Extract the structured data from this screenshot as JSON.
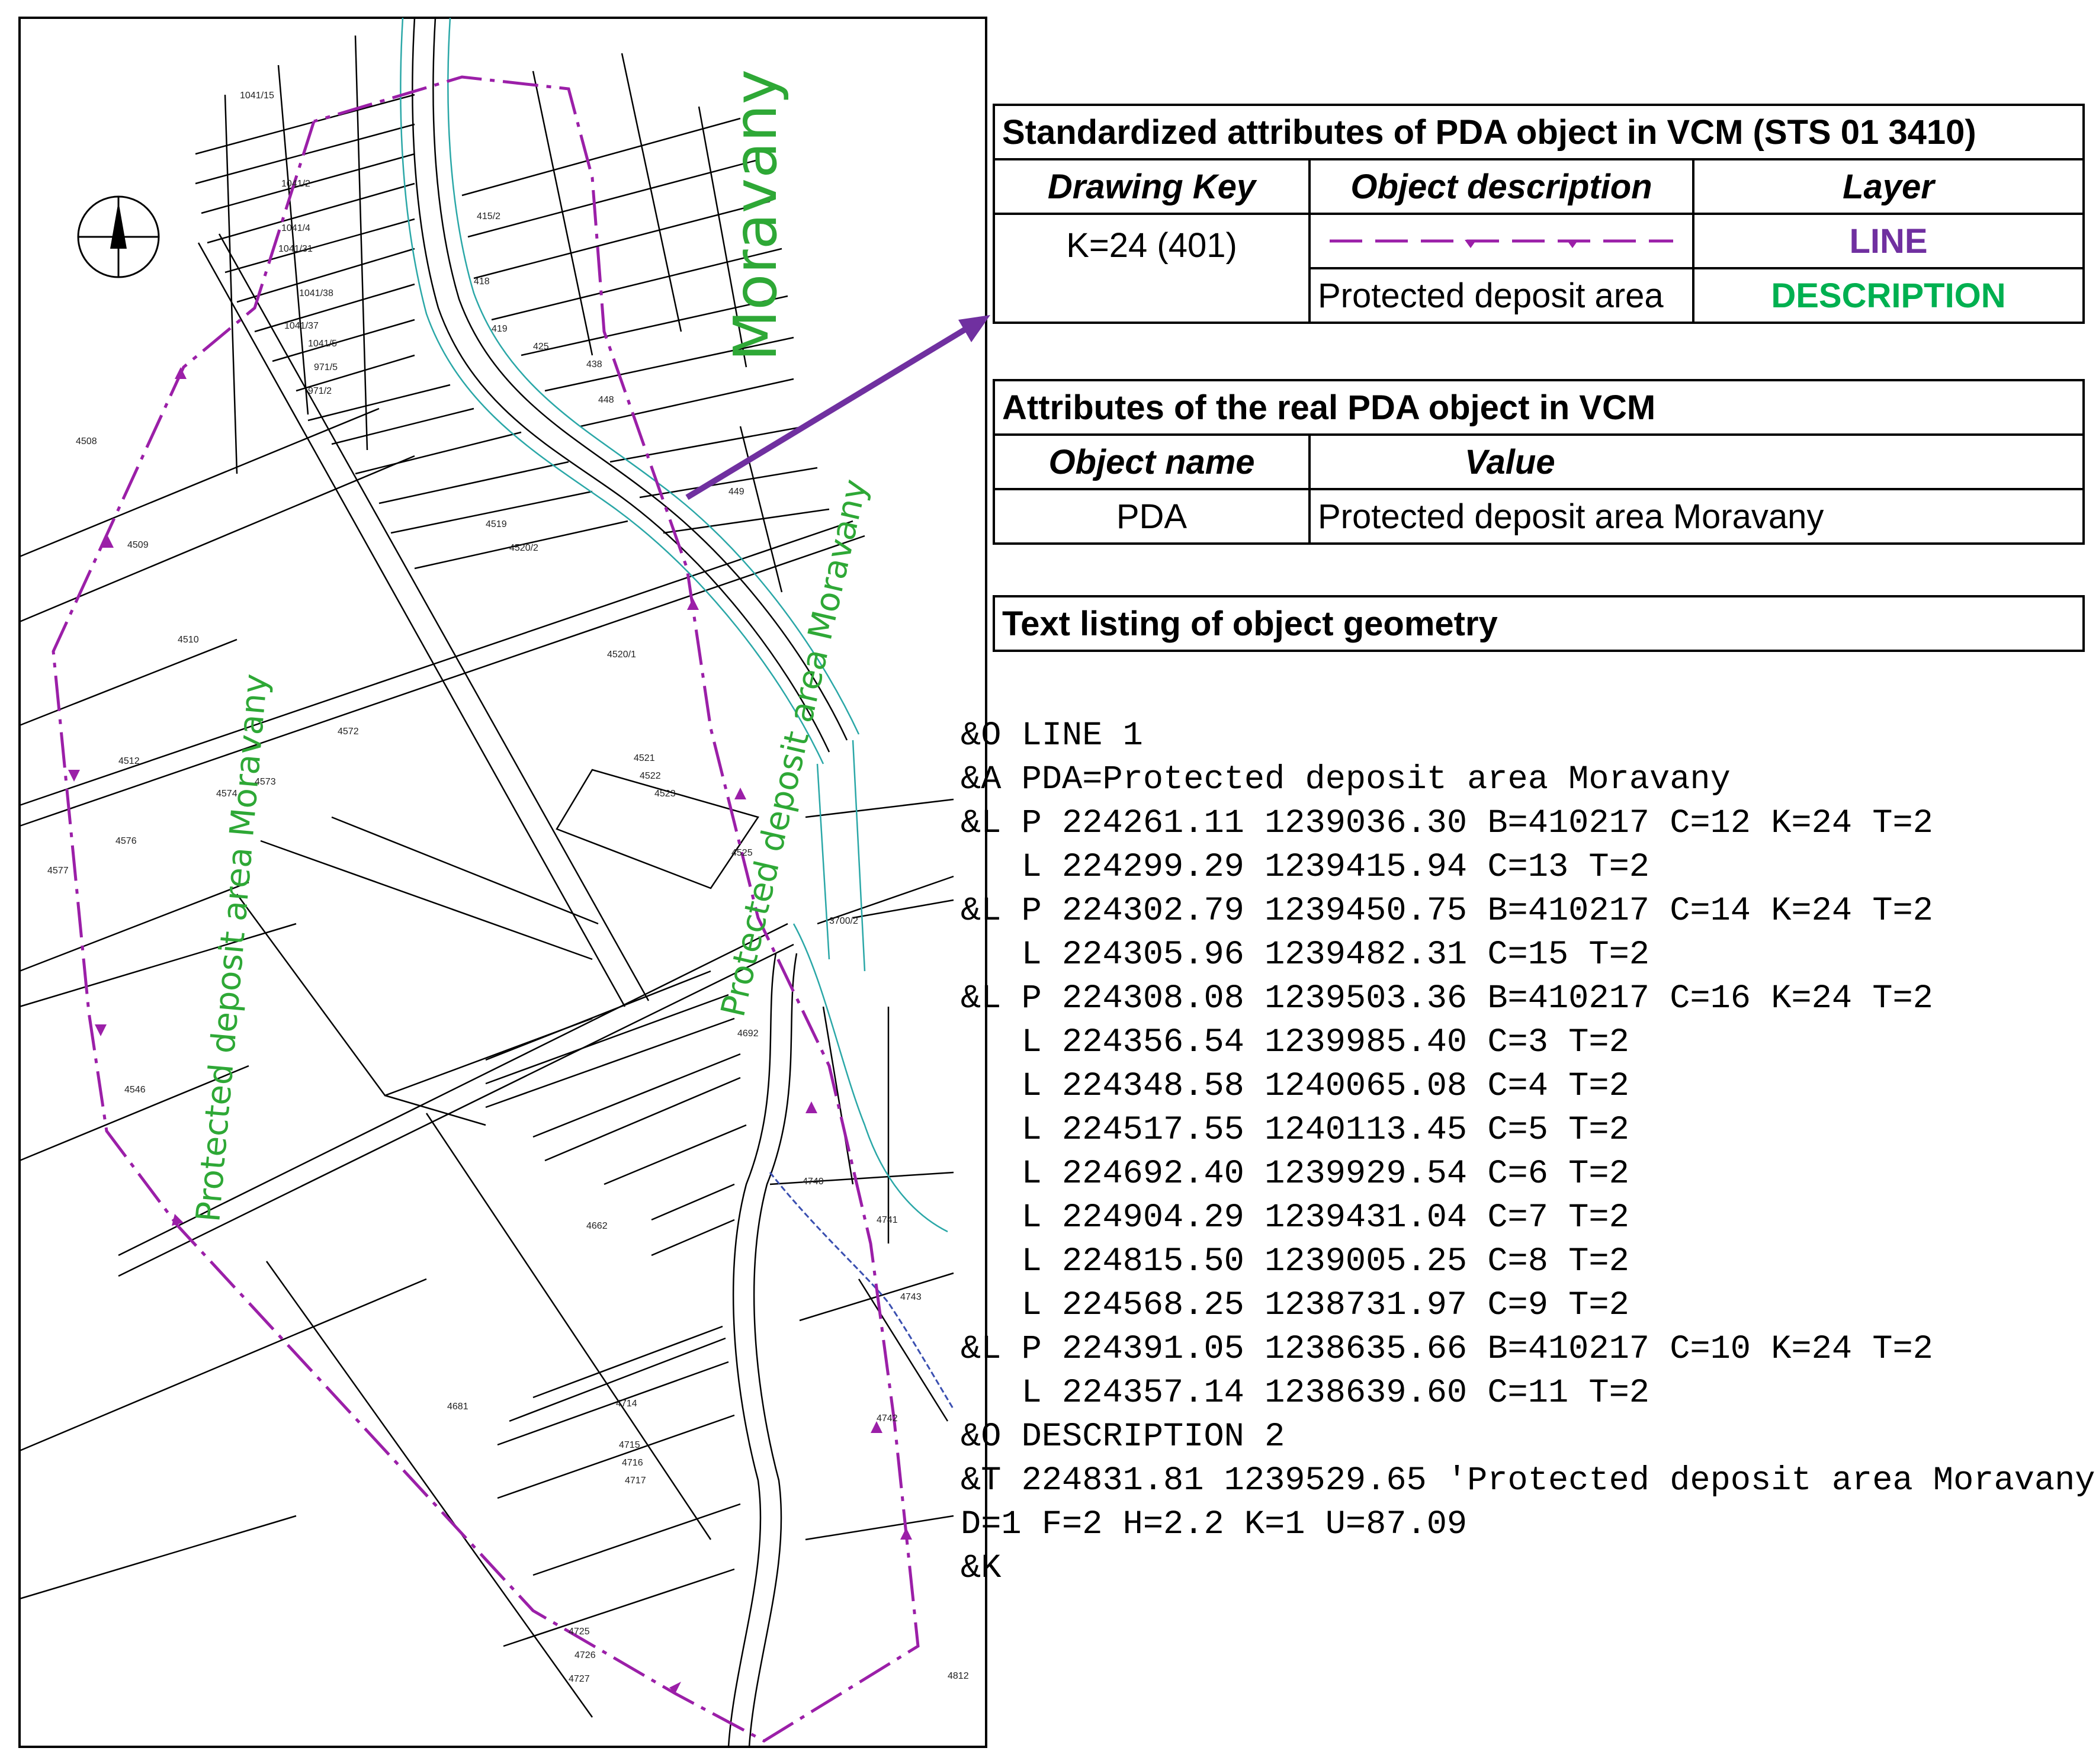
{
  "map": {
    "place_label": "Moravany",
    "area_labels": [
      {
        "text": "Protected deposit area Moravany"
      },
      {
        "text": "Protected deposit area Moravany"
      }
    ],
    "north_arrow_icon": "north-arrow-icon",
    "parcel_numbers": [
      "1041/15",
      "1041/4",
      "1041/2",
      "1041/31",
      "1041/38",
      "1041/37",
      "1041/5",
      "971/5",
      "971/2",
      "4508",
      "4509",
      "4510",
      "4512",
      "4572",
      "4573",
      "4574",
      "4576",
      "4577",
      "4519",
      "4520/2",
      "4520/1",
      "4521",
      "4522",
      "4523",
      "4525",
      "4546",
      "4662",
      "4681",
      "4714",
      "4715",
      "4716",
      "4717",
      "4741",
      "4742",
      "4743",
      "4812",
      "4725",
      "4726",
      "4727",
      "415/2",
      "418",
      "419",
      "425",
      "438",
      "448",
      "449",
      "3700/2",
      "4692",
      "4740"
    ],
    "colors": {
      "boundary_line": "#9b1fa8",
      "label_green": "#2ea836",
      "cadastral_line": "#000000",
      "road_edge": "#2aa7a7",
      "arrow": "#7030a0"
    }
  },
  "table_standard": {
    "title": "Standardized attributes of PDA object in VCM (STS  01 3410)",
    "headers": [
      "Drawing Key",
      "Object description",
      "Layer"
    ],
    "drawing_key": "K=24 (401)",
    "line_symbol_icon": "dashed-boundary-line-icon",
    "layer_line": "LINE",
    "description_text": "Protected deposit area",
    "layer_description": "DESCRIPTION"
  },
  "table_real": {
    "title": "Attributes of the real PDA object in VCM",
    "headers": [
      "Object name",
      "Value"
    ],
    "object_name": "PDA",
    "value": "Protected deposit area Moravany"
  },
  "listing_title": "Text listing of object geometry",
  "listing_lines": [
    "&O LINE 1",
    "&A PDA=Protected deposit area Moravany",
    "&L P 224261.11 1239036.30 B=410217 C=12 K=24 T=2",
    "   L 224299.29 1239415.94 C=13 T=2",
    "&L P 224302.79 1239450.75 B=410217 C=14 K=24 T=2",
    "   L 224305.96 1239482.31 C=15 T=2",
    "&L P 224308.08 1239503.36 B=410217 C=16 K=24 T=2",
    "   L 224356.54 1239985.40 C=3 T=2",
    "   L 224348.58 1240065.08 C=4 T=2",
    "   L 224517.55 1240113.45 C=5 T=2",
    "   L 224692.40 1239929.54 C=6 T=2",
    "   L 224904.29 1239431.04 C=7 T=2",
    "   L 224815.50 1239005.25 C=8 T=2",
    "   L 224568.25 1238731.97 C=9 T=2",
    "&L P 224391.05 1238635.66 B=410217 C=10 K=24 T=2",
    "   L 224357.14 1238639.60 C=11 T=2",
    "&O DESCRIPTION 2",
    "&T 224831.81 1239529.65 'Protected deposit area Moravany'",
    "D=1 F=2 H=2.2 K=1 U=87.09",
    "&K"
  ]
}
